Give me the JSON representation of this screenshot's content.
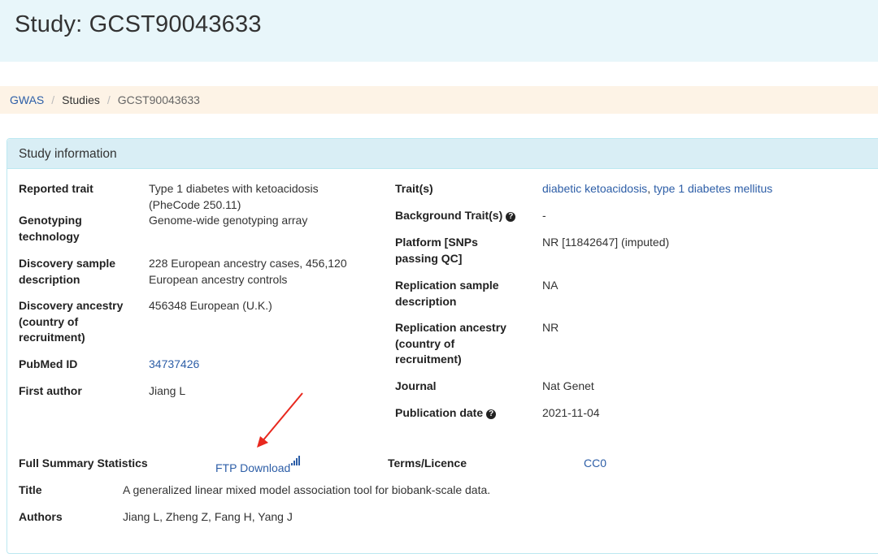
{
  "header": {
    "title": "Study:  GCST90043633"
  },
  "breadcrumb": {
    "items": [
      "GWAS",
      "Studies",
      "GCST90043633"
    ],
    "separator": "/"
  },
  "panel": {
    "heading": "Study information"
  },
  "left": {
    "reported_trait": {
      "label": "Reported trait",
      "value_line1": "Type 1 diabetes with ketoacidosis",
      "value_line2": "(PheCode 250.11)"
    },
    "genotyping": {
      "label_line1": "Genotyping",
      "label_line2": "technology",
      "value": "Genome-wide genotyping array"
    },
    "discovery_sample": {
      "label_line1": "Discovery sample",
      "label_line2": "description",
      "value_line1": "228 European ancestry cases, 456,120",
      "value_line2": "European ancestry controls"
    },
    "discovery_ancestry": {
      "label_line1": "Discovery ancestry",
      "label_line2": "(country of",
      "label_line3": "recruitment)",
      "value": "456348 European (U.K.)"
    },
    "pubmed": {
      "label": "PubMed ID",
      "value": "34737426"
    },
    "first_author": {
      "label": "First author",
      "value": "Jiang L"
    }
  },
  "right": {
    "traits": {
      "label": "Trait(s)",
      "link1": "diabetic ketoacidosis",
      "comma": ",",
      "link2": "type 1 diabetes mellitus"
    },
    "background_traits": {
      "label": "Background Trait(s)",
      "value": "-"
    },
    "platform": {
      "label_line1": "Platform [SNPs",
      "label_line2": "passing QC]",
      "value": "NR [11842647] (imputed)"
    },
    "replication_sample": {
      "label_line1": "Replication sample",
      "label_line2": "description",
      "value": "NA"
    },
    "replication_ancestry": {
      "label_line1": "Replication ancestry",
      "label_line2": "(country of",
      "label_line3": "recruitment)",
      "value": "NR"
    },
    "journal": {
      "label": "Journal",
      "value": "Nat Genet"
    },
    "publication_date": {
      "label": "Publication date",
      "value": "2021-11-04"
    }
  },
  "summary": {
    "label": "Full Summary Statistics",
    "ftp_link": "FTP Download",
    "terms_label": "Terms/Licence",
    "terms_value": "CC0"
  },
  "title_row": {
    "label": "Title",
    "value": "A generalized linear mixed model association tool for biobank-scale data."
  },
  "authors_row": {
    "label": "Authors",
    "value": "Jiang L, Zheng Z, Fang H, Yang J"
  },
  "colors": {
    "header_bg": "#e8f6fa",
    "breadcrumb_bg": "#fdf3e6",
    "panel_heading_bg": "#d9eef5",
    "link": "#2d5ea7",
    "annotation_arrow": "#e8281e"
  },
  "icons": {
    "help": "question-circle-icon",
    "signal": "signal-bars-icon",
    "annotation": "red-arrow-annotation"
  }
}
